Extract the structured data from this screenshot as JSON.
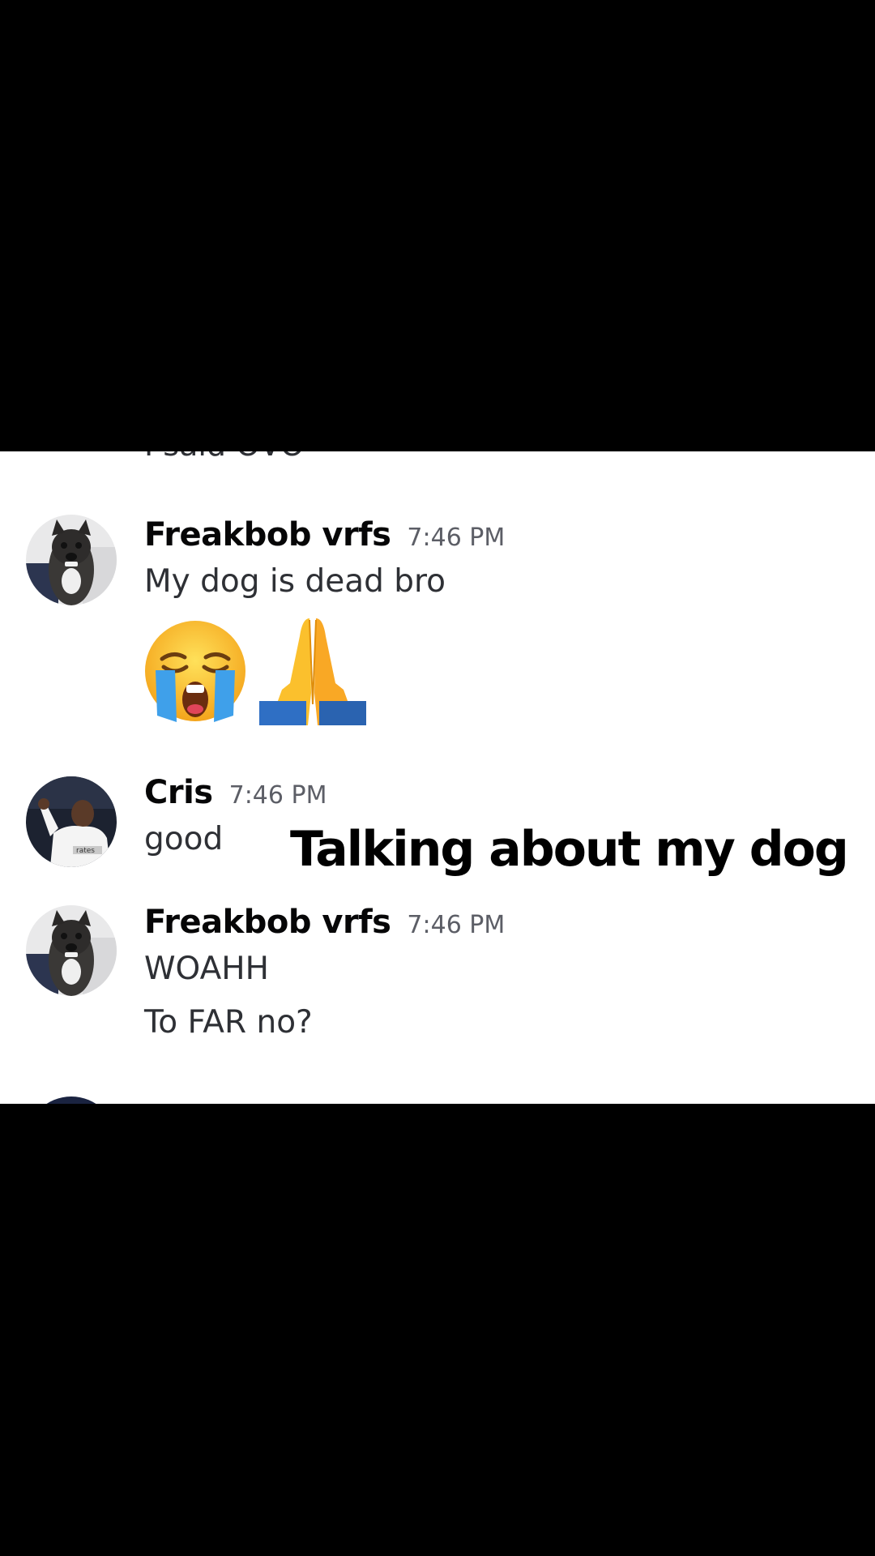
{
  "overlay": {
    "caption": "Talking about my dog"
  },
  "chat": {
    "clipped_previous_line": "I said OVO",
    "messages": [
      {
        "username": "Freakbob vrfs",
        "time": "7:46 PM",
        "avatar": "dog-avatar",
        "lines": [
          "My dog is dead bro"
        ],
        "emojis": [
          "loudly-crying-face-emoji",
          "folded-hands-emoji"
        ]
      },
      {
        "username": "Cris",
        "time": "7:46 PM",
        "avatar": "soccer-player-avatar",
        "lines": [
          "good"
        ]
      },
      {
        "username": "Freakbob vrfs",
        "time": "7:46 PM",
        "avatar": "dog-avatar",
        "lines": [
          "WOAHH",
          "To FAR no?"
        ]
      }
    ]
  },
  "colors": {
    "letterbox": "#000000",
    "chat_background": "#ffffff",
    "username": "#060607",
    "message_text": "#2e3035",
    "timestamp": "#5c5e66"
  }
}
